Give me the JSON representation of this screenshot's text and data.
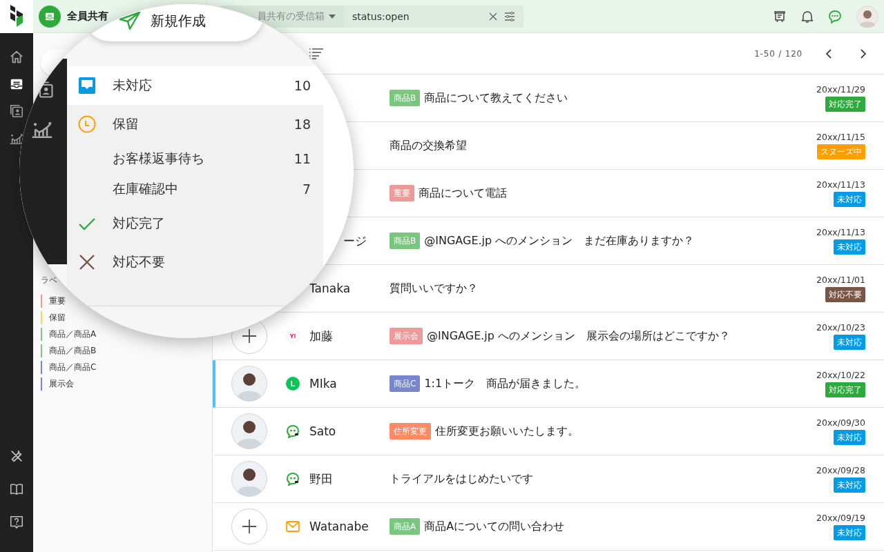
{
  "rail": {
    "top": [
      {
        "kind": "home",
        "selected": false
      },
      {
        "kind": "inbox",
        "selected": true
      },
      {
        "kind": "contacts",
        "selected": false
      },
      {
        "kind": "chart",
        "selected": false
      }
    ],
    "bottom": [
      {
        "kind": "tools"
      },
      {
        "kind": "book"
      },
      {
        "kind": "help"
      }
    ]
  },
  "header": {
    "inbox_name": "全員共有",
    "inbox_select": "員共有の受信箱",
    "search": {
      "value": "status:open"
    }
  },
  "sidebar": {
    "labels_heading": "ラベ",
    "labels": [
      {
        "name": "重要",
        "color": "#ef9a9a"
      },
      {
        "name": "保留",
        "color": "#ffd54f"
      },
      {
        "name": "商品／商品A",
        "color": "#81c784"
      },
      {
        "name": "商品／商品B",
        "color": "#81c784"
      },
      {
        "name": "商品／商品C",
        "color": "#7986cb"
      },
      {
        "name": "展示会",
        "color": "#7986cb"
      }
    ]
  },
  "magnifier": {
    "compose_button": "新規作成",
    "statuses": [
      {
        "kind": "inbox",
        "label": "未対応",
        "count": "10",
        "selected": true
      },
      {
        "kind": "clock",
        "label": "保留",
        "count": "18",
        "selected": false,
        "children": [
          {
            "label": "お客様返事待ち",
            "count": "11",
            "selected": false
          },
          {
            "label": "在庫確認中",
            "count": "7",
            "selected": false
          }
        ]
      },
      {
        "kind": "check",
        "label": "対応完了",
        "selected": false
      },
      {
        "kind": "cross",
        "label": "対応不要",
        "selected": false
      }
    ]
  },
  "list": {
    "pagination": "1-50 / 120",
    "rows": [
      {
        "tag": {
          "text": "商品B",
          "color": "#7bc67e"
        },
        "subject": "商品について教えてください",
        "date": "20xx/11/29",
        "status": {
          "text": "対応完了",
          "color": "#2eaa3c"
        }
      },
      {
        "subject": "商品の交換希望",
        "date": "20xx/11/15",
        "status": {
          "text": "スヌーズ中",
          "color": "#ffa000"
        }
      },
      {
        "tag": {
          "text": "重要",
          "color": "#ef9a9a"
        },
        "subject": "商品について電話",
        "date": "20xx/11/13",
        "status": {
          "text": "未対応",
          "color": "#039be5"
        }
      },
      {
        "name": "ージ",
        "name_cut": true,
        "tag": {
          "text": "商品B",
          "color": "#7bc67e"
        },
        "subject": "@INGAGE.jp へのメンション　まだ在庫ありますか？",
        "date": "20xx/11/13",
        "status": {
          "text": "未対応",
          "color": "#039be5"
        }
      },
      {
        "name": "Tanaka",
        "subject": "質問いいですか？",
        "date": "20xx/11/01",
        "status": {
          "text": "対応不要",
          "color": "#795548"
        }
      },
      {
        "selected": false,
        "avatar": {
          "kind": "add"
        },
        "channel": {
          "kind": "yahoo",
          "text": "Y!"
        },
        "name": "加藤",
        "tag": {
          "text": "展示会",
          "color": "#ef9a9a"
        },
        "subject": "@INGAGE.jp へのメンション　展示会の場所はどこですか？",
        "date": "20xx/10/23",
        "status": {
          "text": "未対応",
          "color": "#039be5"
        }
      },
      {
        "selected": true,
        "avatar": {
          "kind": "photo"
        },
        "channel": {
          "kind": "line",
          "text": "L"
        },
        "name": "MIka",
        "tag": {
          "text": "商品C",
          "color": "#7986cb"
        },
        "subject": "1:1トーク　商品が届きました。",
        "date": "20xx/10/22",
        "status": {
          "text": "対応完了",
          "color": "#2eaa3c"
        }
      },
      {
        "selected": false,
        "avatar": {
          "kind": "photo"
        },
        "channel": {
          "kind": "chat"
        },
        "name": "Sato",
        "tag": {
          "text": "住所変更",
          "color": "#ff8a65"
        },
        "subject": "住所変更お願いいたします。",
        "date": "20xx/09/30",
        "status": {
          "text": "未対応",
          "color": "#039be5"
        }
      },
      {
        "selected": false,
        "avatar": {
          "kind": "photo"
        },
        "channel": {
          "kind": "chat"
        },
        "name": "野田",
        "subject": "トライアルをはじめたいです",
        "date": "20xx/09/28",
        "status": {
          "text": "未対応",
          "color": "#039be5"
        }
      },
      {
        "selected": false,
        "avatar": {
          "kind": "add"
        },
        "channel": {
          "kind": "mail"
        },
        "name": "Watanabe",
        "tag": {
          "text": "商品A",
          "color": "#7bc67e"
        },
        "subject": "商品Aについての問い合わせ",
        "date": "20xx/09/19",
        "status": {
          "text": "未対応",
          "color": "#039be5"
        }
      }
    ]
  }
}
